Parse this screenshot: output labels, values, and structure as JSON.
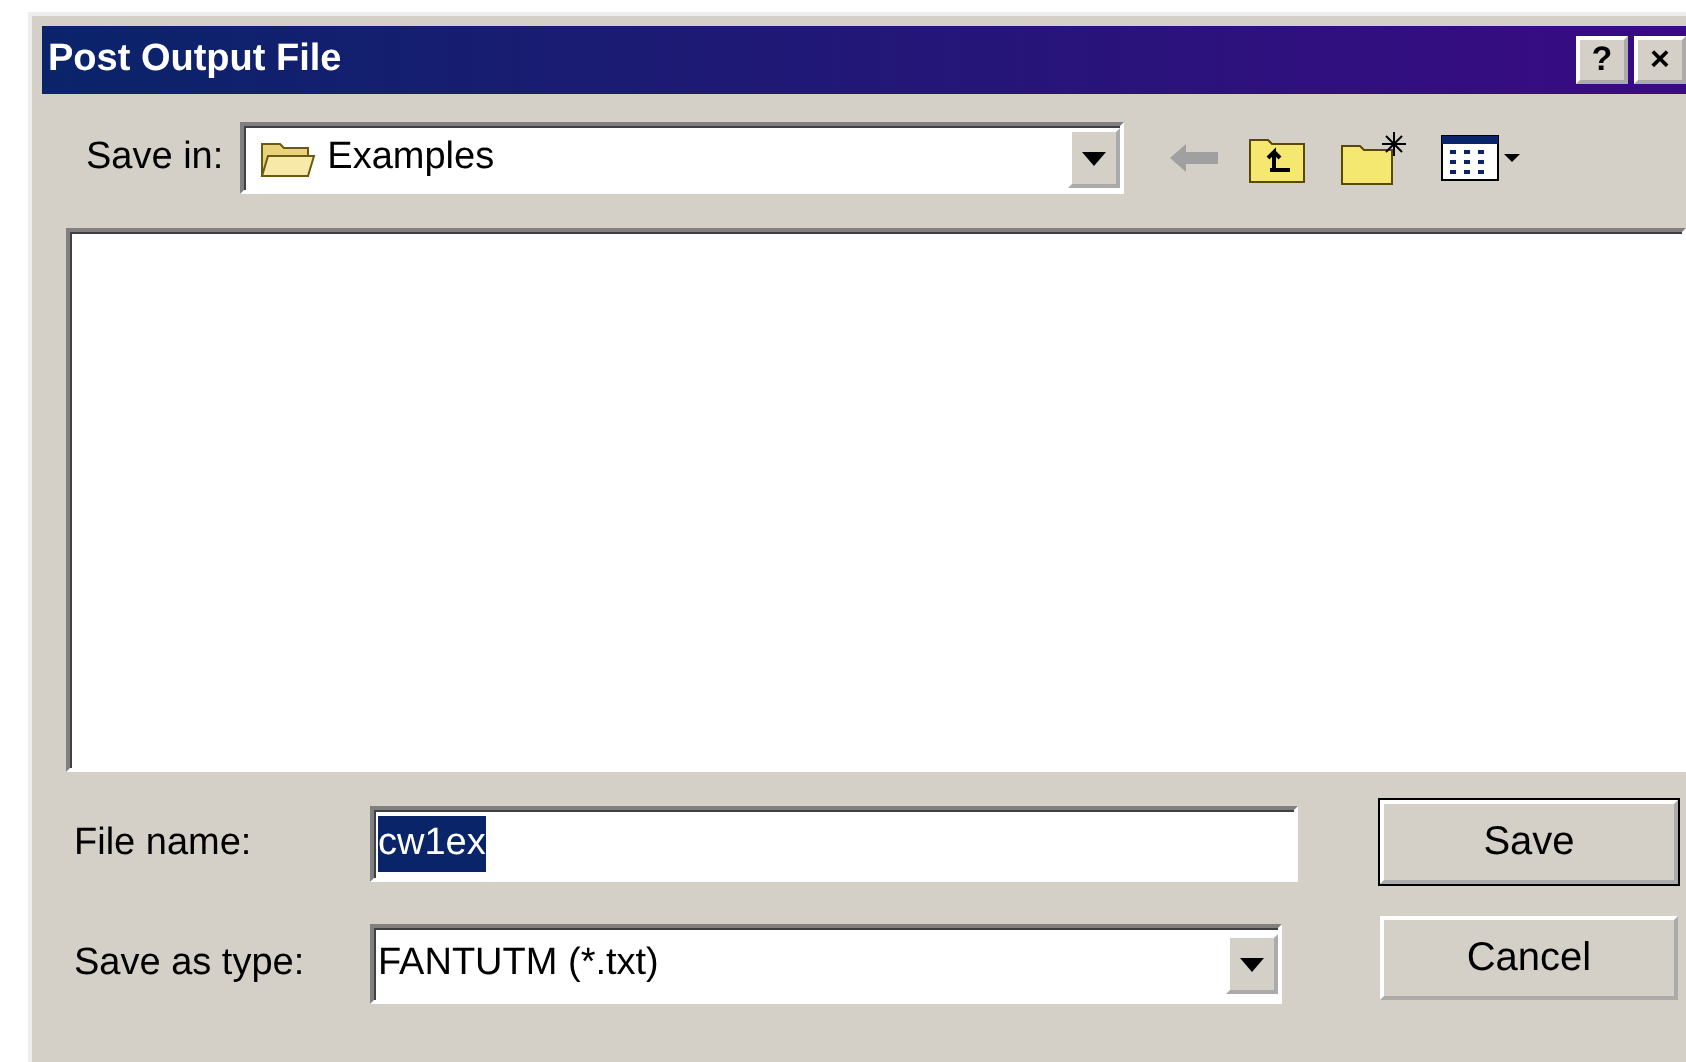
{
  "window": {
    "title": "Post Output File",
    "title_buttons": [
      "?",
      "×"
    ]
  },
  "save_in": {
    "label": "Save in:",
    "value": "Examples"
  },
  "file_name": {
    "label": "File name:",
    "value": "cw1ex",
    "text_selected": true
  },
  "save_as_type": {
    "label": "Save as type:",
    "value": "FANTUTM (*.txt)"
  },
  "buttons": [
    {
      "label": "Save",
      "default": true
    },
    {
      "label": "Cancel",
      "default": false
    }
  ]
}
